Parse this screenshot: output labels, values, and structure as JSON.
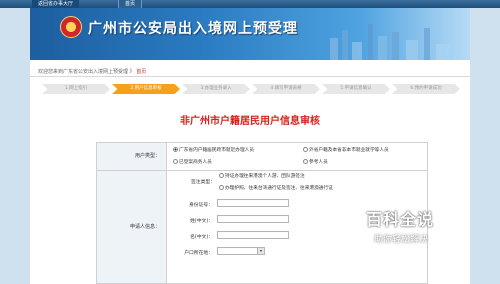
{
  "top_nav": {
    "home_label": "返回省办事大厅",
    "first_label": "首页"
  },
  "banner": {
    "title": "广州市公安局出入境网上预受理"
  },
  "breadcrumb": {
    "prefix": "欢迎您来到广东省公安出入境网上预受理 》",
    "current": "首页"
  },
  "steps": [
    {
      "label": "1.网上指引",
      "active": false
    },
    {
      "label": "2.用户信息审核",
      "active": true
    },
    {
      "label": "3.办理业务录入",
      "active": false
    },
    {
      "label": "4.填写申请表格",
      "active": false
    },
    {
      "label": "5.申请信息确认",
      "active": false
    },
    {
      "label": "6.预约申请成功",
      "active": false
    }
  ],
  "form": {
    "title": "非广州市户籍居民用户信息审核",
    "user_type_label": "用户类型：",
    "user_type_options": [
      {
        "label": "广东省内户籍居民跨市就近办理人员",
        "selected": true
      },
      {
        "label": "外省户籍及本省非本市就业就学等人员",
        "selected": false
      },
      {
        "label": "已登案商务人员",
        "selected": false
      },
      {
        "label": "參考人员",
        "selected": false
      }
    ],
    "applicant_label": "申请人信息：",
    "id_type_label": "签注类型：",
    "id_type_options": [
      {
        "label": "持证办理往来港澳个人游、团队游签注",
        "selected": false
      },
      {
        "label": "办理护照、往来台湾通行证及签注、往来港澳通行证",
        "selected": false
      }
    ],
    "fields": [
      {
        "label": "身份证号：",
        "value": ""
      },
      {
        "label": "姓(中文)：",
        "value": ""
      },
      {
        "label": "名(中文)：",
        "value": ""
      }
    ],
    "residence_label": "户口所在地：",
    "residence_arrow": "▾"
  },
  "watermark": {
    "title": "百科全说",
    "subtitle": "助你轻松解决"
  }
}
